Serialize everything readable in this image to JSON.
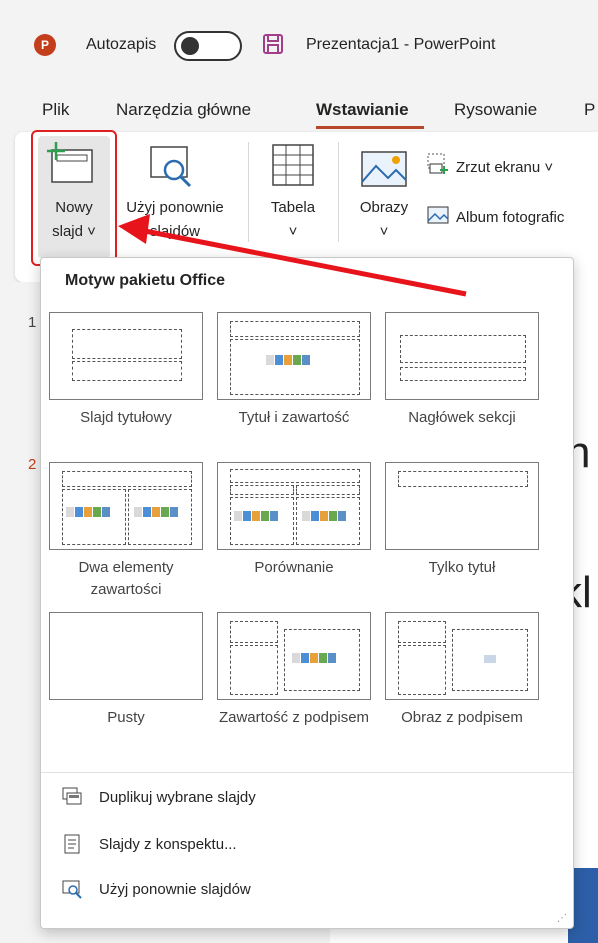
{
  "titlebar": {
    "app_icon_letter": "P",
    "autosave_label": "Autozapis",
    "doc_title": "Prezentacja1  -  PowerPoint"
  },
  "tabs": [
    {
      "label": "Plik"
    },
    {
      "label": "Narzędzia główne"
    },
    {
      "label": "Wstawianie"
    },
    {
      "label": "Rysowanie"
    },
    {
      "label": "P"
    }
  ],
  "ribbon": {
    "new_slide": {
      "line1": "Nowy",
      "line2": "slajd ˅"
    },
    "reuse": {
      "line1": "Użyj ponownie",
      "line2": "slajdów"
    },
    "table": {
      "label": "Tabela",
      "chevron": "˅"
    },
    "images": {
      "label": "Obrazy",
      "chevron": "˅"
    },
    "screenshot": "Zrzut ekranu ˅",
    "album": "Album fotografic"
  },
  "thumbnails": [
    "1",
    "2"
  ],
  "slide_fragments": {
    "a": "h",
    "b": "kl"
  },
  "dropdown": {
    "heading": "Motyw pakietu Office",
    "layouts": [
      {
        "name": "Slajd tytułowy"
      },
      {
        "name": "Tytuł i zawartość"
      },
      {
        "name": "Nagłówek sekcji"
      },
      {
        "name": "Dwa elementy zawartości"
      },
      {
        "name": "Porównanie"
      },
      {
        "name": "Tylko tytuł"
      },
      {
        "name": "Pusty"
      },
      {
        "name": "Zawartość z podpisem"
      },
      {
        "name": "Obraz z podpisem"
      }
    ],
    "commands": [
      {
        "label": "Duplikuj wybrane slajdy",
        "icon": "duplicate-icon"
      },
      {
        "label": "Slajdy z konspektu...",
        "icon": "outline-icon"
      },
      {
        "label": "Użyj ponownie slajdów",
        "icon": "reuse-icon"
      }
    ]
  },
  "colors": {
    "accent": "#b7472a",
    "highlight": "#e02020",
    "app_logo": "#c43e1c"
  }
}
